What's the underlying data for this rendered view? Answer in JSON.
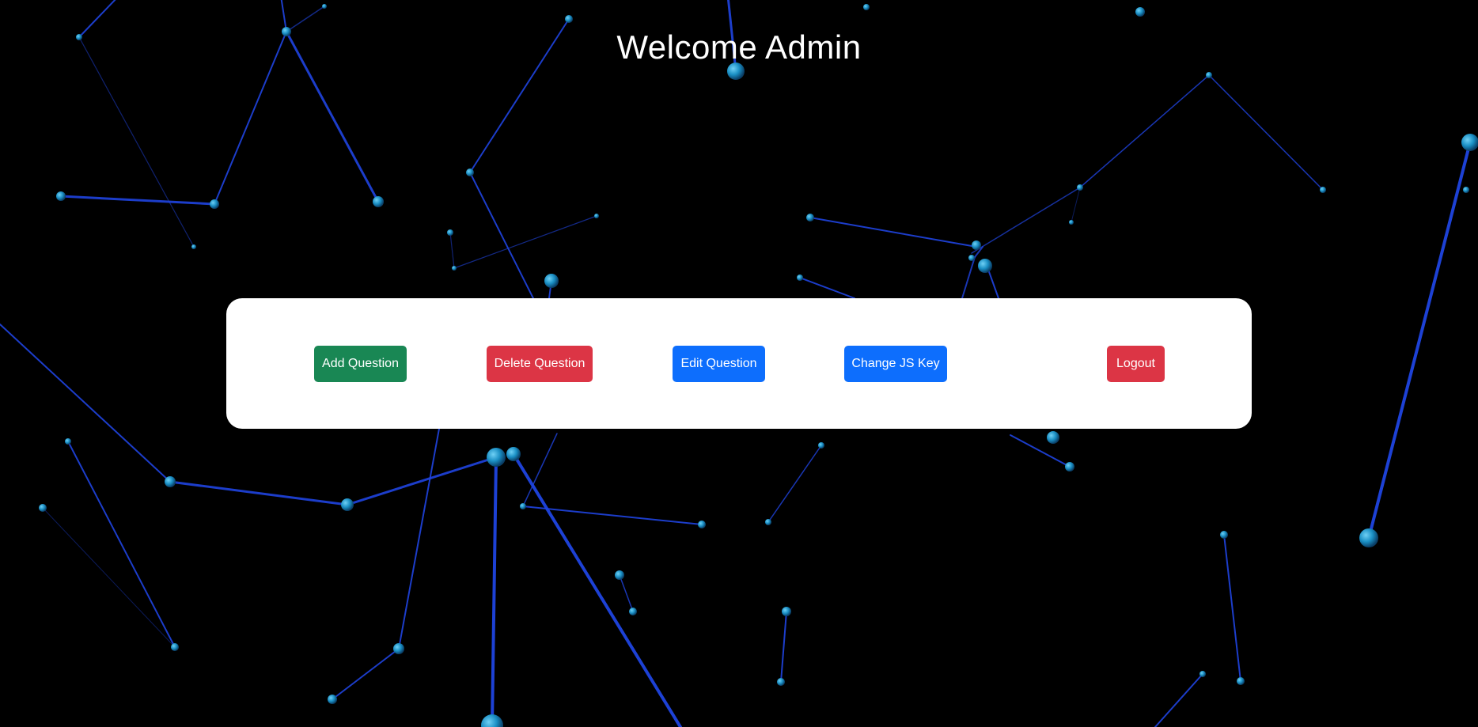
{
  "header": {
    "title": "Welcome Admin"
  },
  "actions": {
    "add_question": "Add Question",
    "delete_question": "Delete Question",
    "edit_question": "Edit Question",
    "change_js_key": "Change JS Key",
    "logout": "Logout"
  },
  "colors": {
    "background": "#000000",
    "panel": "#ffffff",
    "success": "#198754",
    "danger": "#dc3545",
    "primary": "#0d6efd",
    "network_line": "#1f44e0",
    "network_node": "#1a8fc4"
  }
}
